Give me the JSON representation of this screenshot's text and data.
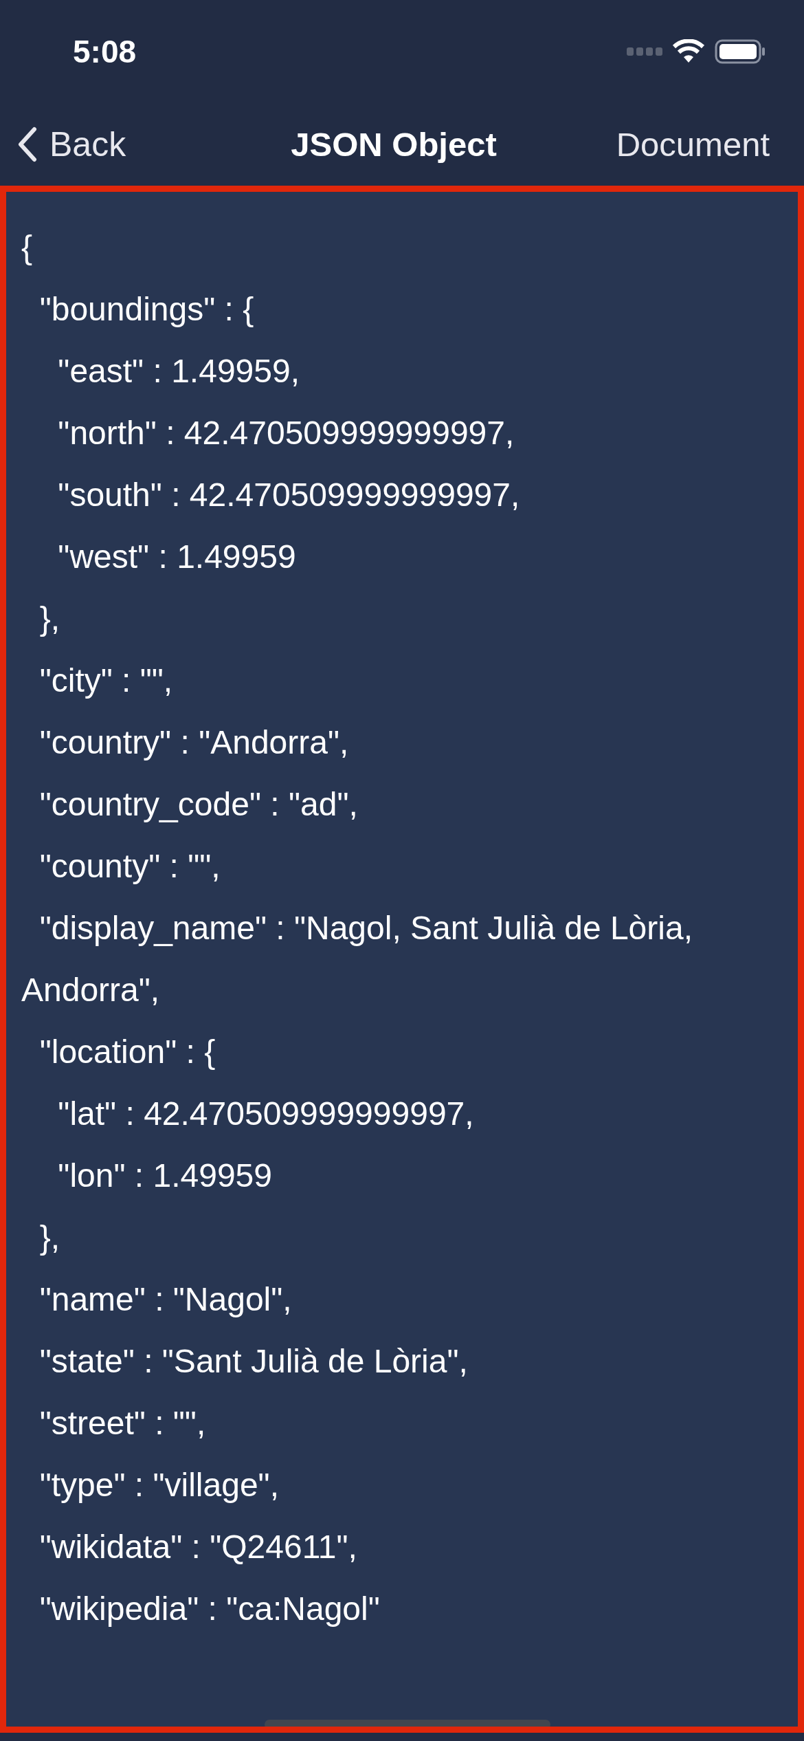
{
  "status_bar": {
    "time": "5:08"
  },
  "nav_bar": {
    "back": "Back",
    "title": "JSON Object",
    "action": "Document"
  },
  "code_lines": [
    "{",
    "  \"boundings\" : {",
    "    \"east\" : 1.49959,",
    "    \"north\" : 42.470509999999997,",
    "    \"south\" : 42.470509999999997,",
    "    \"west\" : 1.49959",
    "  },",
    "  \"city\" : \"\",",
    "  \"country\" : \"Andorra\",",
    "  \"country_code\" : \"ad\",",
    "  \"county\" : \"\",",
    "  \"display_name\" : \"Nagol, Sant Julià de Lòria, Andorra\",",
    "  \"location\" : {",
    "    \"lat\" : 42.470509999999997,",
    "    \"lon\" : 1.49959",
    "  },",
    "  \"name\" : \"Nagol\",",
    "  \"state\" : \"Sant Julià de Lòria\",",
    "  \"street\" : \"\",",
    "  \"type\" : \"village\",",
    "  \"wikidata\" : \"Q24611\",",
    "  \"wikipedia\" : \"ca:Nagol\""
  ]
}
